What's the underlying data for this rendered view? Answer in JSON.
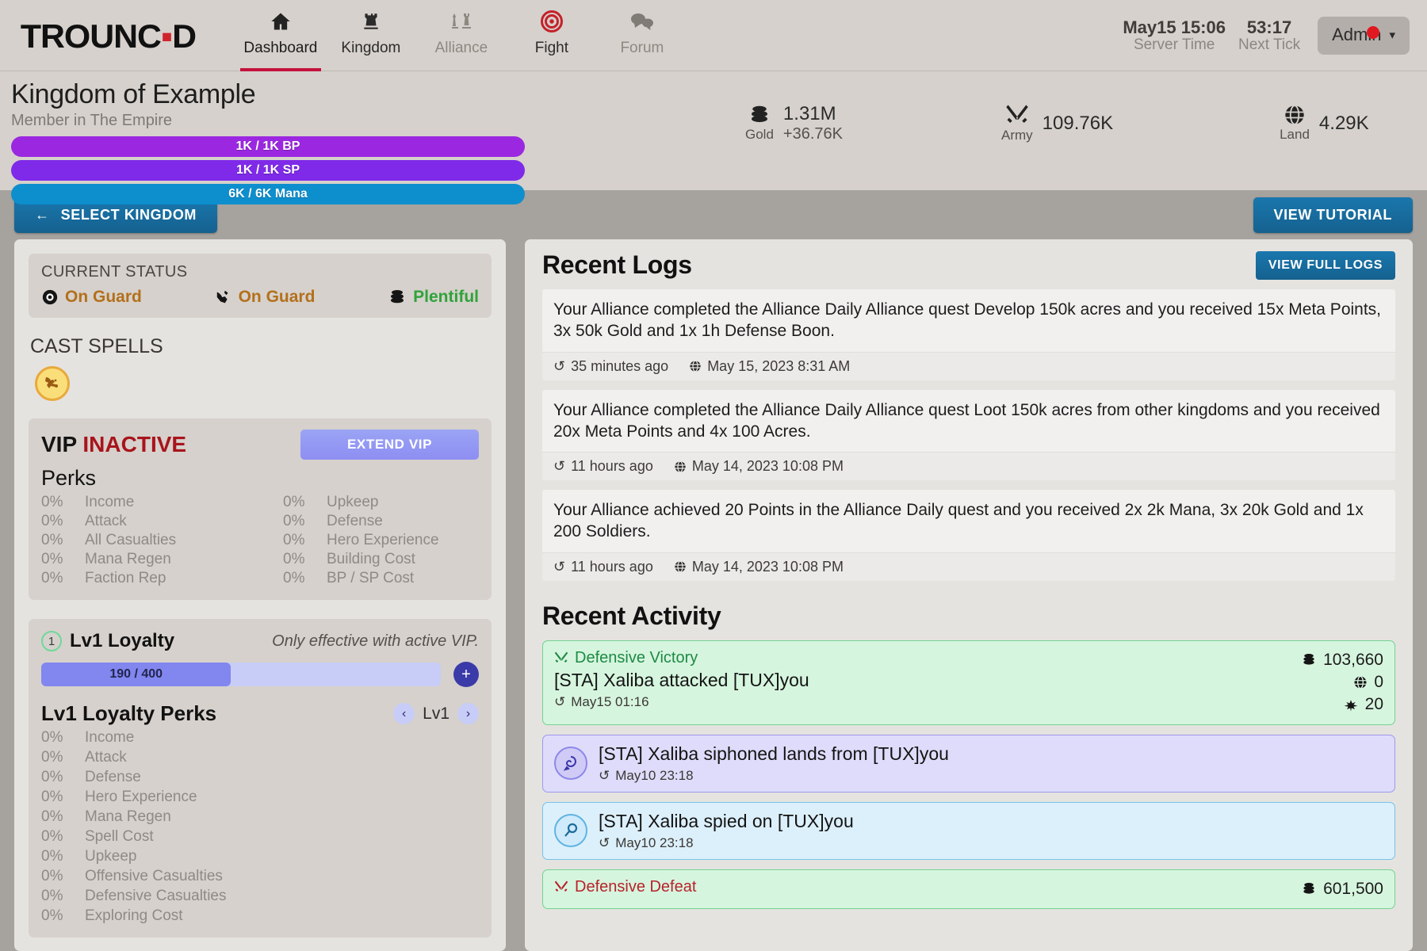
{
  "header": {
    "logo_before": "TROUNC",
    "logo_dot": "▪",
    "logo_after": "D",
    "logo_full": "TROUNCED",
    "nav": [
      {
        "label": "Dashboard",
        "icon": "home-icon",
        "active": true
      },
      {
        "label": "Kingdom",
        "icon": "castle-tower-icon",
        "active": false
      },
      {
        "label": "Alliance",
        "icon": "chess-pieces-icon",
        "active": false
      },
      {
        "label": "Fight",
        "icon": "target-icon",
        "active": false
      },
      {
        "label": "Forum",
        "icon": "speech-bubbles-icon",
        "active": false
      }
    ],
    "server_time_value": "May15 15:06",
    "server_time_label": "Server Time",
    "next_tick_value": "53:17",
    "next_tick_label": "Next Tick",
    "account_label": "Admin"
  },
  "kingdom": {
    "name": "Kingdom of Example",
    "membership": "Member in The Empire",
    "bars": [
      {
        "label": "1K / 1K BP",
        "type": "bp",
        "color": "#9b28e0"
      },
      {
        "label": "1K / 1K SP",
        "type": "sp",
        "color": "#7f2ae8"
      },
      {
        "label": "6K / 6K Mana",
        "type": "mana",
        "color": "#0d8fce"
      }
    ],
    "resources": [
      {
        "icon": "gold-coins-icon",
        "name": "Gold",
        "value": "1.31M",
        "delta": "+36.76K"
      },
      {
        "icon": "crossed-swords-icon",
        "name": "Army",
        "value": "109.76K",
        "delta": ""
      },
      {
        "icon": "globe-icon",
        "name": "Land",
        "value": "4.29K",
        "delta": ""
      }
    ]
  },
  "actionbar": {
    "select_kingdom": "SELECT KINGDOM",
    "back_arrow": "←",
    "view_tutorial": "VIEW TUTORIAL"
  },
  "sidebar": {
    "status_title": "CURRENT STATUS",
    "status_items": [
      {
        "icon": "eye-icon",
        "label": "On Guard",
        "color": "#b3701b"
      },
      {
        "icon": "thief-hand-icon",
        "label": "On Guard",
        "color": "#b3701b"
      },
      {
        "icon": "gold-coins-icon",
        "label": "Plentiful",
        "color": "#2fa33a"
      }
    ],
    "cast_spells_title": "CAST SPELLS",
    "spell_icon": "gold-spell-icon",
    "vip": {
      "title": "VIP",
      "state": "INACTIVE",
      "extend_label": "EXTEND VIP",
      "perks_title": "Perks",
      "perks": [
        {
          "value": "0%",
          "label": "Income"
        },
        {
          "value": "0%",
          "label": "Upkeep"
        },
        {
          "value": "0%",
          "label": "Attack"
        },
        {
          "value": "0%",
          "label": "Defense"
        },
        {
          "value": "0%",
          "label": "All Casualties"
        },
        {
          "value": "0%",
          "label": "Hero Experience"
        },
        {
          "value": "0%",
          "label": "Mana Regen"
        },
        {
          "value": "0%",
          "label": "Building Cost"
        },
        {
          "value": "0%",
          "label": "Faction Rep"
        },
        {
          "value": "0%",
          "label": "BP / SP Cost"
        }
      ]
    },
    "loyalty": {
      "level_badge": "1",
      "title": "Lv1 Loyalty",
      "note": "Only effective with active VIP.",
      "progress_label": "190 / 400",
      "progress_current": 190,
      "progress_max": 400,
      "add_label": "+",
      "perks_title": "Lv1 Loyalty Perks",
      "prev_arrow": "‹",
      "level_label": "Lv1",
      "next_arrow": "›",
      "perks": [
        {
          "value": "0%",
          "label": "Income"
        },
        {
          "value": "0%",
          "label": "Attack"
        },
        {
          "value": "0%",
          "label": "Defense"
        },
        {
          "value": "0%",
          "label": "Hero Experience"
        },
        {
          "value": "0%",
          "label": "Mana Regen"
        },
        {
          "value": "0%",
          "label": "Spell Cost"
        },
        {
          "value": "0%",
          "label": "Upkeep"
        },
        {
          "value": "0%",
          "label": "Offensive Casualties"
        },
        {
          "value": "0%",
          "label": "Defensive Casualties"
        },
        {
          "value": "0%",
          "label": "Exploring Cost"
        }
      ]
    }
  },
  "logs": {
    "title": "Recent Logs",
    "view_full_label": "VIEW FULL LOGS",
    "items": [
      {
        "text": "Your Alliance completed the Alliance Daily Alliance quest Develop 150k acres and you received 15x Meta Points, 3x 50k Gold and 1x 1h Defense Boon.",
        "relative": "35 minutes ago",
        "absolute": "May 15, 2023 8:31 AM"
      },
      {
        "text": "Your Alliance completed the Alliance Daily Alliance quest Loot 150k acres from other kingdoms and you received 20x Meta Points and 4x 100 Acres.",
        "relative": "11 hours ago",
        "absolute": "May 14, 2023 10:08 PM"
      },
      {
        "text": "Your Alliance achieved 20 Points in the Alliance Daily quest and you received 2x 2k Mana, 3x 20k Gold and 1x 200 Soldiers.",
        "relative": "11 hours ago",
        "absolute": "May 14, 2023 10:08 PM"
      }
    ]
  },
  "activity": {
    "title": "Recent Activity",
    "items": [
      {
        "style": "green",
        "kind": "Defensive Victory",
        "kind_style": "win",
        "kind_icon": "crossed-swords-icon",
        "text": "[STA] Xaliba attacked [TUX]you",
        "time": "May15 01:16",
        "stats": [
          {
            "icon": "gold-coins-icon",
            "value": "103,660"
          },
          {
            "icon": "globe-icon",
            "value": "0"
          },
          {
            "icon": "soldiers-icon",
            "value": "20"
          }
        ]
      },
      {
        "style": "purple",
        "kind": "",
        "kind_style": "",
        "badge_icon": "siphon-spell-icon",
        "badge_style": "purple",
        "text": "[STA] Xaliba siphoned lands from [TUX]you",
        "time": "May10 23:18",
        "stats": []
      },
      {
        "style": "blue",
        "kind": "",
        "kind_style": "",
        "badge_icon": "spy-magnifier-icon",
        "badge_style": "blue",
        "text": "[STA] Xaliba spied on [TUX]you",
        "time": "May10 23:18",
        "stats": []
      },
      {
        "style": "green",
        "kind": "Defensive Defeat",
        "kind_style": "loss",
        "kind_icon": "crossed-swords-icon",
        "text": "",
        "time": "",
        "stats": [
          {
            "icon": "gold-coins-icon",
            "value": "601,500"
          }
        ]
      }
    ]
  }
}
